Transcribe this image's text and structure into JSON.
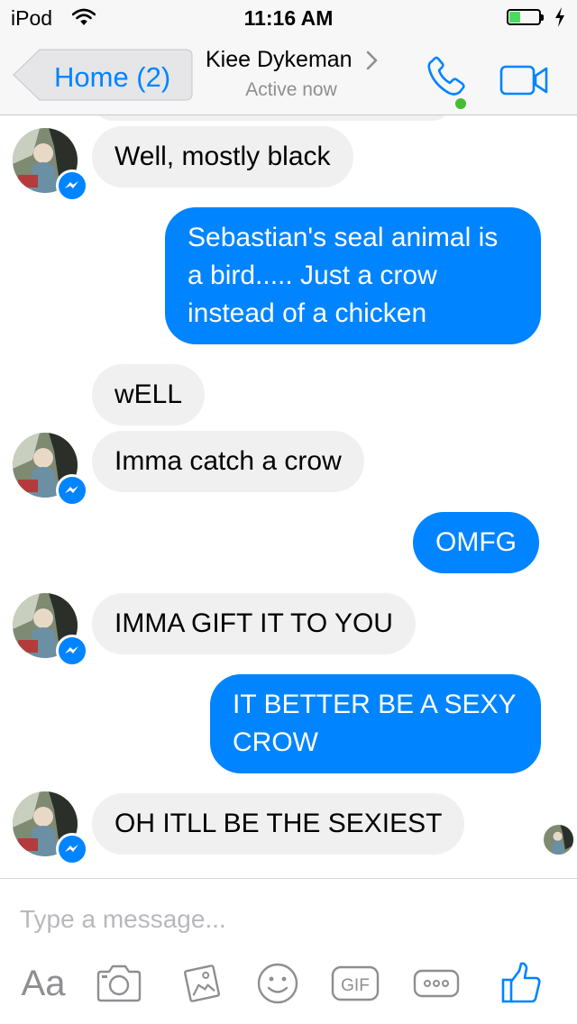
{
  "status_bar": {
    "device": "iPod",
    "time": "11:16 AM",
    "battery_level": 0.4
  },
  "nav": {
    "back_label": "Home (2)",
    "contact_name": "Kiee Dykeman",
    "contact_status": "Active now",
    "icons": [
      "chevron-left-icon",
      "chevron-right-icon",
      "phone-icon",
      "video-camera-icon"
    ]
  },
  "messages": [
    {
      "sender": "contact",
      "text": "Well, mostly black"
    },
    {
      "sender": "me",
      "text": "Sebastian's seal animal is a bird..... Just a crow instead of a chicken"
    },
    {
      "sender": "contact",
      "text": "wELL"
    },
    {
      "sender": "contact",
      "text": "Imma catch a crow"
    },
    {
      "sender": "me",
      "text": "OMFG"
    },
    {
      "sender": "contact",
      "text": "IMMA GIFT IT TO YOU"
    },
    {
      "sender": "me",
      "text": "IT BETTER BE A SEXY CROW"
    },
    {
      "sender": "contact",
      "text": "OH ITLL BE THE SEXIEST"
    }
  ],
  "composer": {
    "placeholder": "Type a message...",
    "text_tool_label": "Aa",
    "gif_label": "GIF",
    "icons": [
      "camera-icon",
      "photo-gallery-icon",
      "emoji-icon",
      "gif-icon",
      "more-icon",
      "thumbs-up-icon"
    ]
  },
  "colors": {
    "accent": "#0084ff",
    "incoming_bubble": "#f1f0f0",
    "outgoing_bubble": "#0084ff",
    "online": "#44bd32"
  }
}
